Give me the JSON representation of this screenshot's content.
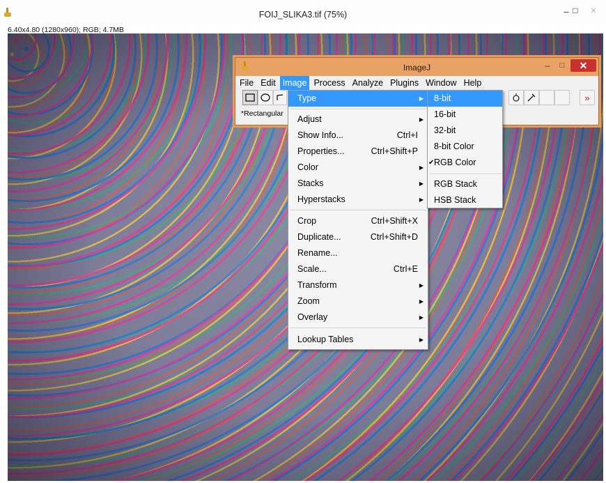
{
  "image_window": {
    "title": "FOIJ_SLIKA3.tif (75%)",
    "info": "6.40x4.80  (1280x960); RGB; 4.7MB",
    "minimize": "–",
    "maximize": "□",
    "close": "✕"
  },
  "imagej_window": {
    "title": "ImageJ",
    "minimize": "–",
    "maximize": "□",
    "close": "✕",
    "menus": [
      "File",
      "Edit",
      "Image",
      "Process",
      "Analyze",
      "Plugins",
      "Window",
      "Help"
    ],
    "active_menu": "Image",
    "status": "*Rectangular",
    "more_tools": "»",
    "tools": [
      "rectangle-tool-icon",
      "oval-tool-icon",
      "polygon-tool-icon",
      "hand-tool-icon",
      "dropper-tool-icon"
    ]
  },
  "image_menu": {
    "items": [
      {
        "label": "Type",
        "submenu": true,
        "highlighted": true
      },
      {
        "label": "Adjust",
        "submenu": true
      },
      {
        "label": "Show Info...",
        "shortcut": "Ctrl+I"
      },
      {
        "label": "Properties...",
        "shortcut": "Ctrl+Shift+P"
      },
      {
        "label": "Color",
        "submenu": true
      },
      {
        "label": "Stacks",
        "submenu": true
      },
      {
        "label": "Hyperstacks",
        "submenu": true
      },
      {
        "label": "Crop",
        "shortcut": "Ctrl+Shift+X"
      },
      {
        "label": "Duplicate...",
        "shortcut": "Ctrl+Shift+D"
      },
      {
        "label": "Rename..."
      },
      {
        "label": "Scale...",
        "shortcut": "Ctrl+E"
      },
      {
        "label": "Transform",
        "submenu": true
      },
      {
        "label": "Zoom",
        "submenu": true
      },
      {
        "label": "Overlay",
        "submenu": true
      },
      {
        "label": "Lookup Tables",
        "submenu": true
      }
    ]
  },
  "type_submenu": {
    "items": [
      {
        "label": "8-bit",
        "highlighted": true
      },
      {
        "label": "16-bit"
      },
      {
        "label": "32-bit"
      },
      {
        "label": "8-bit Color"
      },
      {
        "label": "RGB Color",
        "checked": true
      },
      {
        "label": "RGB Stack"
      },
      {
        "label": "HSB Stack"
      }
    ],
    "check_mark": "✔"
  },
  "colors": {
    "menu_highlight": "#3399ff",
    "imagej_titlebar": "#e9a264",
    "close_button": "#c8322e"
  }
}
